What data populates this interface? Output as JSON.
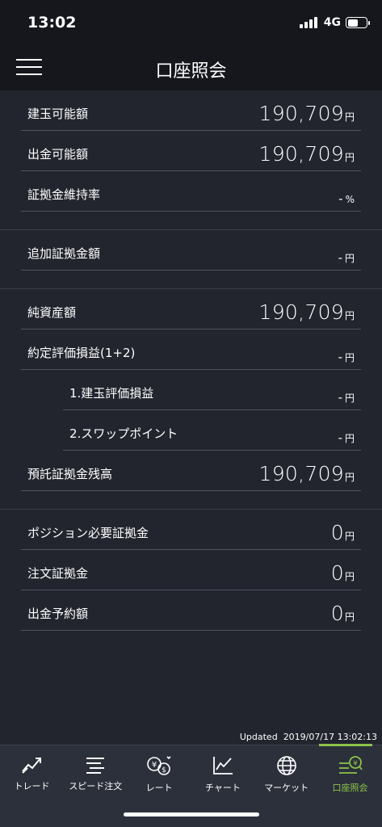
{
  "status_bar": {
    "time": "13:02",
    "network": "4G"
  },
  "header": {
    "title": "口座照会"
  },
  "sections": [
    {
      "rows": [
        {
          "label": "建玉可能額",
          "value": "190,709",
          "unit": "円",
          "big": true,
          "indent": false
        },
        {
          "label": "出金可能額",
          "value": "190,709",
          "unit": "円",
          "big": true,
          "indent": false
        },
        {
          "label": "証拠金維持率",
          "value": "-",
          "unit": "%",
          "big": false,
          "indent": false
        }
      ]
    },
    {
      "rows": [
        {
          "label": "追加証拠金額",
          "value": "-",
          "unit": "円",
          "big": false,
          "indent": false
        }
      ]
    },
    {
      "rows": [
        {
          "label": "純資産額",
          "value": "190,709",
          "unit": "円",
          "big": true,
          "indent": false
        },
        {
          "label": "約定評価損益(1+2)",
          "value": "-",
          "unit": "円",
          "big": false,
          "indent": false
        },
        {
          "label": "1.建玉評価損益",
          "value": "-",
          "unit": "円",
          "big": false,
          "indent": true
        },
        {
          "label": "2.スワップポイント",
          "value": "-",
          "unit": "円",
          "big": false,
          "indent": true
        },
        {
          "label": "預託証拠金残高",
          "value": "190,709",
          "unit": "円",
          "big": true,
          "indent": false
        }
      ]
    },
    {
      "rows": [
        {
          "label": "ポジション必要証拠金",
          "value": "0",
          "unit": "円",
          "big": true,
          "indent": false
        },
        {
          "label": "注文証拠金",
          "value": "0",
          "unit": "円",
          "big": true,
          "indent": false
        },
        {
          "label": "出金予約額",
          "value": "0",
          "unit": "円",
          "big": true,
          "indent": false
        }
      ]
    }
  ],
  "updated": {
    "label": "Updated",
    "timestamp": "2019/07/17 13:02:13"
  },
  "tabs": [
    {
      "id": "trade",
      "label": "トレード",
      "icon": "trade-icon",
      "active": false
    },
    {
      "id": "speed",
      "label": "スピード注文",
      "icon": "speed-order-icon",
      "active": false
    },
    {
      "id": "rate",
      "label": "レート",
      "icon": "rate-icon",
      "active": false
    },
    {
      "id": "chart",
      "label": "チャート",
      "icon": "chart-icon",
      "active": false
    },
    {
      "id": "market",
      "label": "マーケット",
      "icon": "globe-icon",
      "active": false
    },
    {
      "id": "account",
      "label": "口座照会",
      "icon": "account-icon",
      "active": true
    }
  ],
  "colors": {
    "accent": "#8bc34a",
    "background": "#22252e",
    "header": "#15171c",
    "tabbar": "#2c303b"
  }
}
